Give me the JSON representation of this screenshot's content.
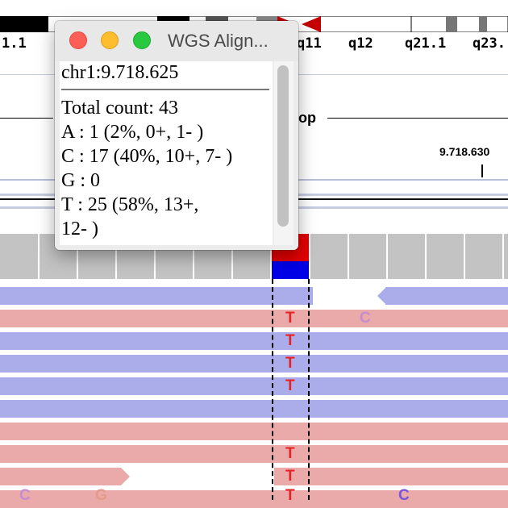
{
  "ideogram": {
    "band_labels": [
      "1.1",
      "q11",
      "q12",
      "q21.1",
      "q23."
    ]
  },
  "tracks": {
    "gene_label": "op",
    "position_label": "9.718.630"
  },
  "popup": {
    "title": "WGS Align...",
    "locus": "chr1:9.718.625",
    "lines": [
      "Total count: 43",
      "A : 1 (2%, 0+, 1- )",
      "C : 17 (40%, 10+, 7- )",
      "G : 0",
      "T : 25 (58%, 13+,",
      "12- )"
    ]
  },
  "reads": {
    "bases": [
      "T",
      "C",
      "T",
      "T",
      "T",
      "T",
      "T",
      "T",
      "C",
      "G",
      "C"
    ]
  },
  "colors": {
    "forward_read": "#eaaaa9",
    "reverse_read": "#abacea",
    "mismatch_T": "#e5242a",
    "coverage_gray": "#c3c3c3",
    "coverage_red": "#e30000",
    "coverage_blue": "#0000e6"
  }
}
